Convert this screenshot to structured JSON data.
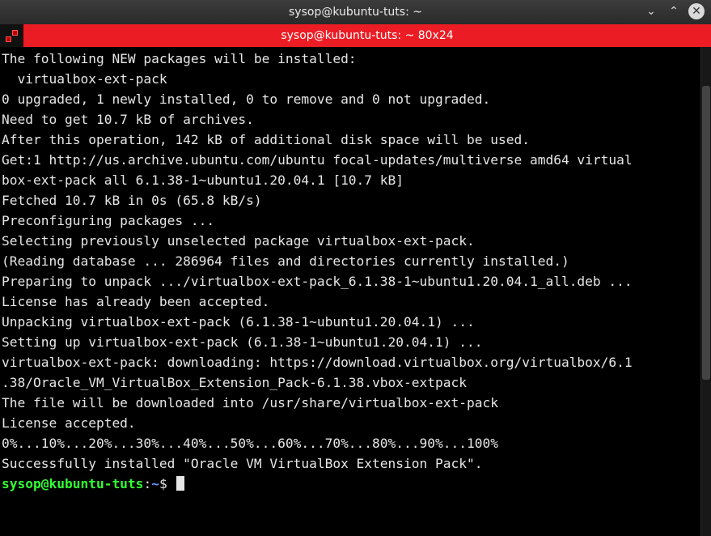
{
  "window": {
    "title": "sysop@kubuntu-tuts: ~"
  },
  "tab": {
    "title": "sysop@kubuntu-tuts: ~ 80x24"
  },
  "controls": {
    "minimize": "⌄",
    "maximize": "⌃",
    "close": "✕"
  },
  "prompt": {
    "user_host": "sysop@kubuntu-tuts",
    "sep": ":",
    "path": "~",
    "symbol": "$"
  },
  "lines": [
    "The following NEW packages will be installed:",
    "  virtualbox-ext-pack",
    "0 upgraded, 1 newly installed, 0 to remove and 0 not upgraded.",
    "Need to get 10.7 kB of archives.",
    "After this operation, 142 kB of additional disk space will be used.",
    "Get:1 http://us.archive.ubuntu.com/ubuntu focal-updates/multiverse amd64 virtual",
    "box-ext-pack all 6.1.38-1~ubuntu1.20.04.1 [10.7 kB]",
    "Fetched 10.7 kB in 0s (65.8 kB/s)",
    "Preconfiguring packages ...",
    "Selecting previously unselected package virtualbox-ext-pack.",
    "(Reading database ... 286964 files and directories currently installed.)",
    "Preparing to unpack .../virtualbox-ext-pack_6.1.38-1~ubuntu1.20.04.1_all.deb ...",
    "License has already been accepted.",
    "Unpacking virtualbox-ext-pack (6.1.38-1~ubuntu1.20.04.1) ...",
    "Setting up virtualbox-ext-pack (6.1.38-1~ubuntu1.20.04.1) ...",
    "virtualbox-ext-pack: downloading: https://download.virtualbox.org/virtualbox/6.1",
    ".38/Oracle_VM_VirtualBox_Extension_Pack-6.1.38.vbox-extpack",
    "The file will be downloaded into /usr/share/virtualbox-ext-pack",
    "License accepted.",
    "0%...10%...20%...30%...40%...50%...60%...70%...80%...90%...100%",
    "Successfully installed \"Oracle VM VirtualBox Extension Pack\"."
  ]
}
